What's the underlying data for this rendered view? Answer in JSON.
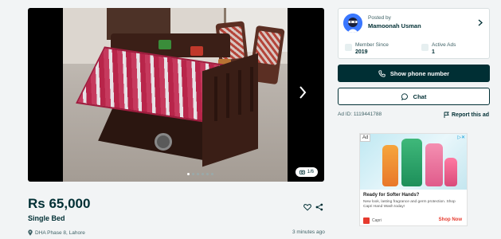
{
  "gallery": {
    "counter": "1/6",
    "slides": 6,
    "active_slide": 1,
    "next_icon": "chevron-right-icon",
    "camera_icon": "camera-icon"
  },
  "listing": {
    "price": "Rs 65,000",
    "title": "Single Bed",
    "location": "DHA Phase 8, Lahore",
    "posted": "3 minutes ago"
  },
  "seller": {
    "posted_by_label": "Posted by",
    "name": "Mamoonah Usman",
    "member_since_label": "Member Since",
    "member_since": "2019",
    "active_ads_label": "Active Ads",
    "active_ads": "1"
  },
  "actions": {
    "show_phone": "Show phone number",
    "chat": "Chat",
    "ad_id": "Ad ID: 1119441788",
    "report": "Report this ad"
  },
  "advert": {
    "tag": "Ad",
    "headline": "Ready for Softer Hands?",
    "body": "New look, lasting fragrance and germ protection. Shop Capri Hand Wash today!",
    "brand": "Capri",
    "cta": "Shop Now"
  },
  "colors": {
    "primary": "#002f34",
    "background": "#f2f4f5",
    "ad_accent": "#e63a2e"
  }
}
